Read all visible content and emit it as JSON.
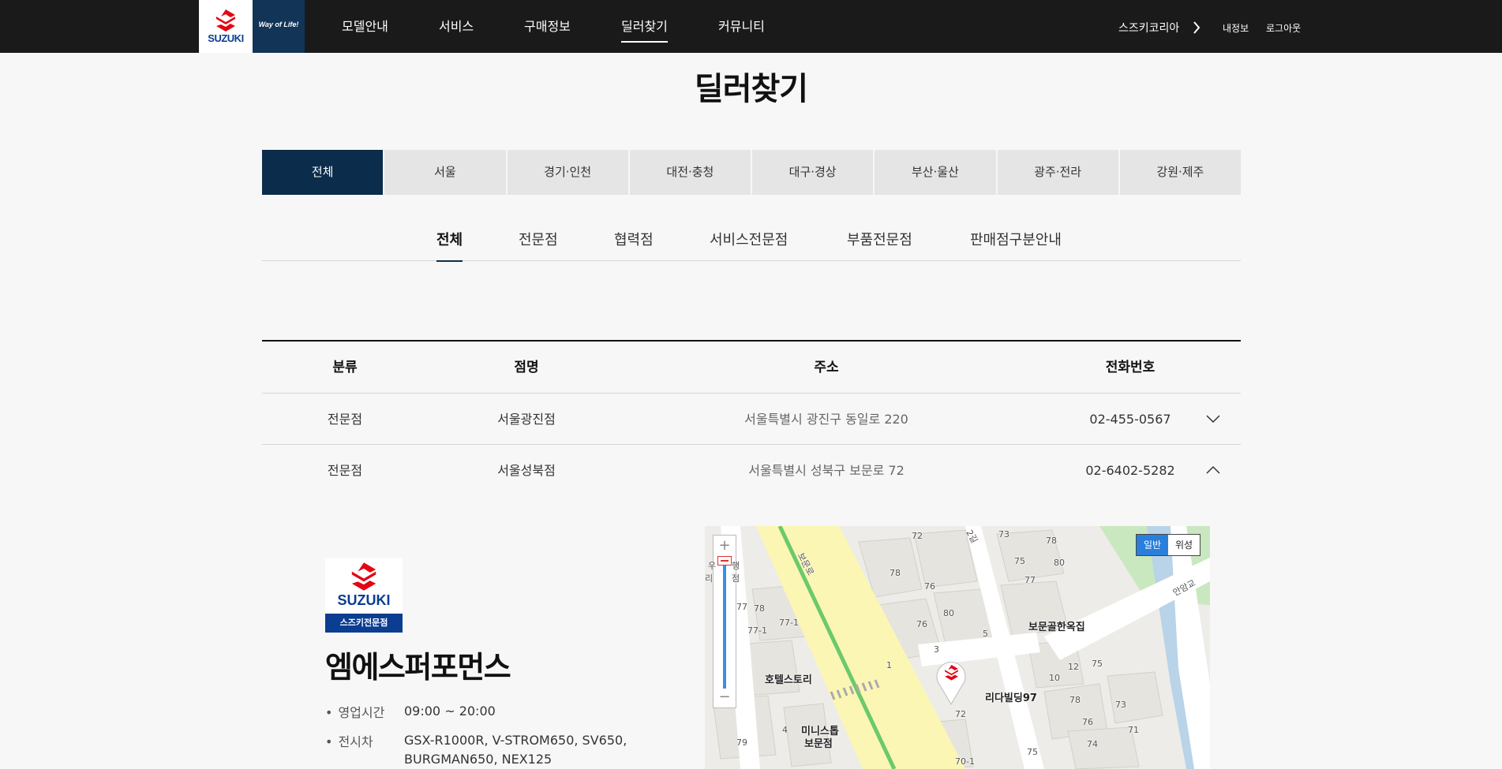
{
  "header": {
    "logo_word": "SUZUKI",
    "slogan": "Way of Life!",
    "menu": [
      "모델안내",
      "서비스",
      "구매정보",
      "딜러찾기",
      "커뮤니티"
    ],
    "active_menu": "딜러찾기",
    "util": {
      "brand_link": "스즈키코리아",
      "my_info": "내정보",
      "logout": "로그아웃"
    }
  },
  "page_title": "딜러찾기",
  "region_tabs": [
    "전체",
    "서울",
    "경기·인천",
    "대전·충청",
    "대구·경상",
    "부산·울산",
    "광주·전라",
    "강원·제주"
  ],
  "active_region": "전체",
  "type_tabs": [
    "전체",
    "전문점",
    "협력점",
    "서비스전문점",
    "부품전문점",
    "판매점구분안내"
  ],
  "active_type": "전체",
  "table": {
    "headers": [
      "분류",
      "점명",
      "주소",
      "전화번호"
    ],
    "rows": [
      {
        "type": "전문점",
        "name": "서울광진점",
        "address": "서울특별시 광진구 동일로 220",
        "phone": "02-455-0567",
        "expanded": false
      },
      {
        "type": "전문점",
        "name": "서울성북점",
        "address": "서울특별시 성북구 보문로 72",
        "phone": "02-6402-5282",
        "expanded": true
      }
    ]
  },
  "detail": {
    "logo_word": "SUZUKI",
    "badge": "스즈키전문점",
    "dealer_name": "엠에스퍼포먼스",
    "hours_label": "영업시간",
    "hours_value": "09:00 ~ 20:00",
    "display_label": "전시차",
    "display_line1": "GSX-R1000R, V-STROM650, SV650,",
    "display_line2": "BURGMAN650, NEX125"
  },
  "map": {
    "zoom_in": "+",
    "zoom_out": "−",
    "type_normal": "일반",
    "type_satellite": "위성",
    "labels": {
      "boreo": "보문로",
      "bridge": "안암교",
      "restaurant": "보문골한옥집",
      "hotel": "호텔스토리",
      "building": "리다빌딩97",
      "ministop_1": "미니스톱",
      "ministop_2": "보문점",
      "partial_1": "우",
      "partial_2": "행",
      "partial_3": "리",
      "partial_4": "점",
      "lane": "2길",
      "numbers": [
        "72",
        "73",
        "78",
        "75",
        "80",
        "77",
        "78",
        "76",
        "80",
        "76",
        "3",
        "5",
        "1",
        "72",
        "12",
        "75",
        "10",
        "78",
        "73",
        "76",
        "71",
        "74",
        "75",
        "70-1",
        "79",
        "77",
        "77-1",
        "77-1",
        "4",
        "78"
      ]
    }
  },
  "colors": {
    "header_bg": "#1a1a1a",
    "navy": "#0b2c4a",
    "suzuki_red": "#e30613",
    "suzuki_blue": "#0b3d91",
    "map_road": "#fbf6b4",
    "map_green": "#6cc96c",
    "map_blue": "#2a7fdc"
  }
}
